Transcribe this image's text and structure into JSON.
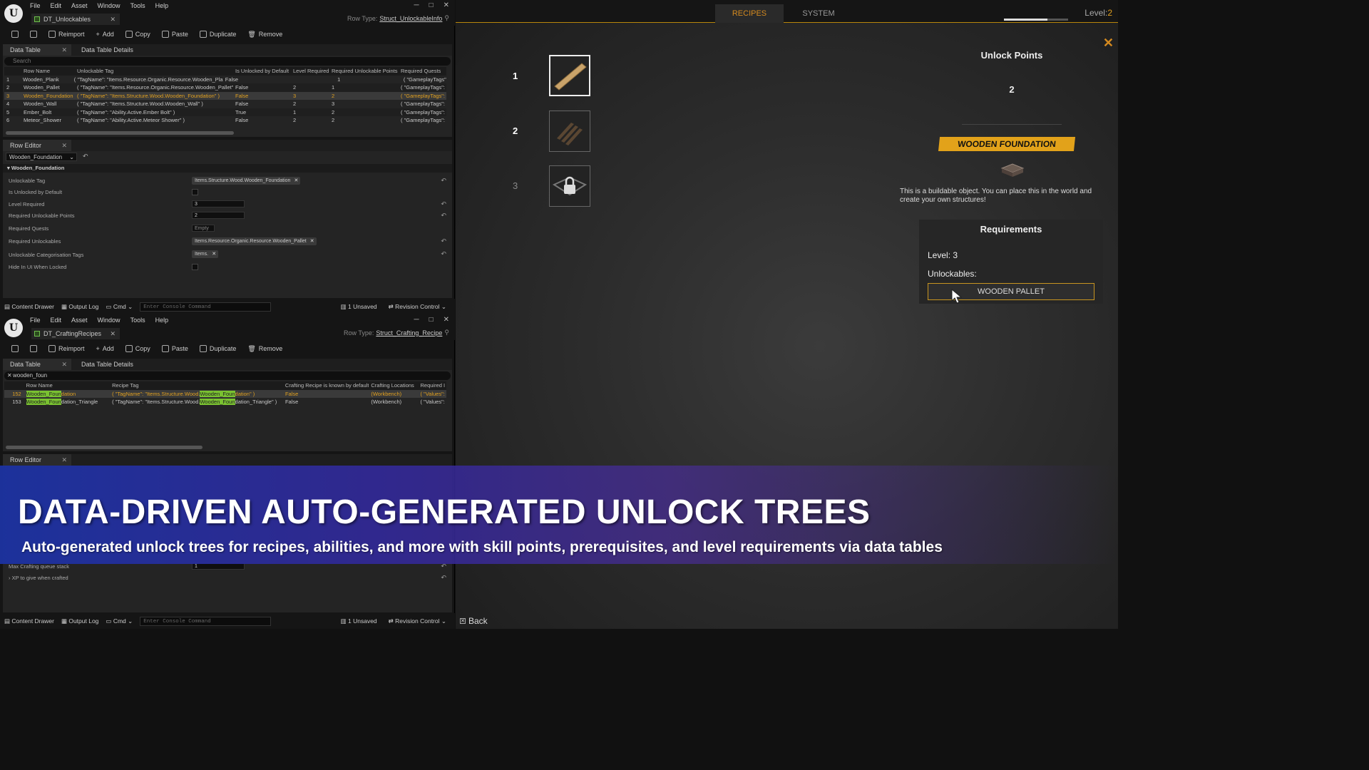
{
  "editor_top": {
    "menu": [
      "File",
      "Edit",
      "Asset",
      "Window",
      "Tools",
      "Help"
    ],
    "doc_tab": "DT_Unlockables",
    "row_type_label": "Row Type:",
    "row_type_value": "Struct_UnlockableInfo",
    "toolbar": {
      "reimport": "Reimport",
      "add": "Add",
      "copy": "Copy",
      "paste": "Paste",
      "duplicate": "Duplicate",
      "remove": "Remove"
    },
    "tab_data_table": "Data Table",
    "tab_details": "Data Table Details",
    "search_placeholder": "Search",
    "columns": [
      "",
      "Row Name",
      "Unlockable Tag",
      "Is Unlocked by Default",
      "Level Required",
      "Required Unlockable Points",
      "Required Quests"
    ],
    "rows": [
      [
        "1",
        "Wooden_Plank",
        "( \"TagName\": \"Items.Resource.Organic.Resource.Wooden_Plank\" )",
        "False",
        "1",
        "1",
        "( \"GameplayTags\":"
      ],
      [
        "2",
        "Wooden_Pallet",
        "( \"TagName\": \"Items.Resource.Organic.Resource.Wooden_Pallet\" )",
        "False",
        "2",
        "1",
        "( \"GameplayTags\":"
      ],
      [
        "3",
        "Wooden_Foundation",
        "( \"TagName\": \"Items.Structure.Wood.Wooden_Foundation\" )",
        "False",
        "3",
        "2",
        "( \"GameplayTags\":"
      ],
      [
        "4",
        "Wooden_Wall",
        "( \"TagName\": \"Items.Structure.Wood.Wooden_Wall\" )",
        "False",
        "2",
        "3",
        "( \"GameplayTags\":"
      ],
      [
        "5",
        "Ember_Bolt",
        "( \"TagName\": \"Ability.Active.Ember Bolt\" )",
        "True",
        "1",
        "2",
        "( \"GameplayTags\":"
      ],
      [
        "6",
        "Meteor_Shower",
        "( \"TagName\": \"Ability.Active.Meteor Shower\" )",
        "False",
        "2",
        "2",
        "( \"GameplayTags\":"
      ]
    ],
    "row_editor_tab": "Row Editor",
    "row_select": "Wooden_Foundation",
    "section": "Wooden_Foundation",
    "fields": {
      "unlockable_tag": "Unlockable Tag",
      "unlockable_tag_val": "Items.Structure.Wood.Wooden_Foundation",
      "is_unlocked": "Is Unlocked by Default",
      "level_required": "Level Required",
      "level_required_val": "3",
      "req_points": "Required Unlockable Points",
      "req_points_val": "2",
      "req_quests": "Required Quests",
      "req_quests_val": "Empty",
      "req_unlockables": "Required Unlockables",
      "req_unlockables_val": "Items.Resource.Organic.Resource.Wooden_Pallet",
      "categorisation": "Unlockable Categorisation Tags",
      "categorisation_val": "Items.",
      "hide_locked": "Hide In UI When Locked"
    },
    "status": {
      "content_drawer": "Content Drawer",
      "output_log": "Output Log",
      "cmd": "Cmd",
      "console_placeholder": "Enter Console Command",
      "unsaved": "1 Unsaved",
      "revision": "Revision Control"
    }
  },
  "editor_bottom": {
    "doc_tab": "DT_CraftingRecipes",
    "row_type_label": "Row Type:",
    "row_type_value": "Struct_Crafting_Recipe",
    "search_value": "wooden_foun",
    "columns": [
      "",
      "Row Name",
      "Recipe Tag",
      "Crafting Recipe is known by default",
      "Crafting Locations",
      "Required I"
    ],
    "rows": [
      {
        "num": "152",
        "name_hl": "Wooden_Foun",
        "name_rest": "dation",
        "tag_pre": "( \"TagName\": \"Items.Structure.Wood.",
        "tag_hl": "Wooden_Foun",
        "tag_post": "dation\" )",
        "known": "False",
        "loc": "(Workbench)",
        "req": "( \"Values\":"
      },
      {
        "num": "153",
        "name_hl": "Wooden_Foun",
        "name_rest": "dation_Triangle",
        "tag_pre": "( \"TagName\": \"Items.Structure.Wood.",
        "tag_hl": "Wooden_Foun",
        "tag_post": "dation_Triangle\" )",
        "known": "False",
        "loc": "(Workbench)",
        "req": "( \"Values\":"
      }
    ],
    "field_max_queue": "Max Crafting queue stack",
    "field_max_queue_val": "1",
    "field_xp": "XP to give when crafted"
  },
  "game": {
    "tab_recipes": "RECIPES",
    "tab_system": "SYSTEM",
    "level_label": "Level:",
    "level_value": "2",
    "xp_progress": 0.68,
    "tiers": [
      "1",
      "2",
      "3"
    ],
    "detail_title": "Unlock Points",
    "detail_points": "2",
    "item_name": "WOODEN FOUNDATION",
    "item_desc": "This is a buildable object. You can place this in the world and create your own structures!",
    "req_title": "Requirements",
    "req_level": "Level: 3",
    "req_unlockables": "Unlockables:",
    "req_item": "WOODEN PALLET",
    "back": "Back"
  },
  "overlay": {
    "title": "DATA-DRIVEN AUTO-GENERATED UNLOCK TREES",
    "subtitle": "Auto-generated unlock trees for recipes, abilities, and more with skill points, prerequisites, and level requirements via data tables"
  },
  "colors": {
    "accent": "#e2a21a",
    "overlay": "#1c32a0",
    "highlight": "#7ac231"
  }
}
